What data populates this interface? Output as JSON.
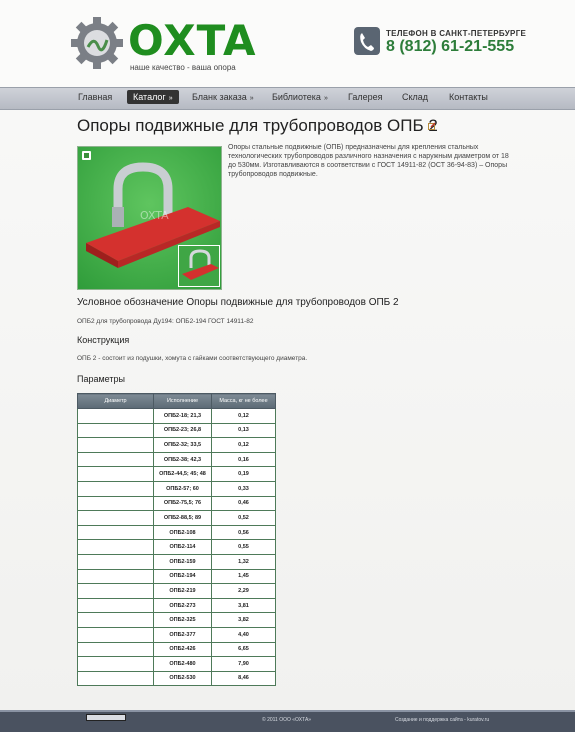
{
  "header": {
    "logo_text": "OXTA",
    "slogan": "наше качество - ваша опора",
    "phone_label": "ТЕЛЕФОН В САНКТ-ПЕТЕРБУРГЕ",
    "phone_number": "8 (812) 61-21-555"
  },
  "nav": [
    {
      "label": "Главная",
      "arrow": ""
    },
    {
      "label": "Каталог",
      "arrow": "»"
    },
    {
      "label": "Бланк заказа",
      "arrow": "»"
    },
    {
      "label": "Библиотека",
      "arrow": "»"
    },
    {
      "label": "Галерея",
      "arrow": ""
    },
    {
      "label": "Склад",
      "arrow": ""
    },
    {
      "label": "Контакты",
      "arrow": ""
    }
  ],
  "page": {
    "title": "Опоры подвижные для трубопроводов ОПБ 2",
    "description": "Опоры стальные подвижные (ОПБ) предназначены для крепления стальных технологических трубопроводов различного назначения с наружным диаметром от 18 до 530мм. Изготавливаются в соответствии с ГОСТ 14911-82 (ОСТ 36-94-83)  – Опоры трубопроводов подвижные.",
    "watermark": "OXTA",
    "subtitle_designation": "Условное обозначение Опоры подвижные для трубопроводов ОПБ 2",
    "designation_text": "ОПБ2 для трубопровода Ду194: ОПБ2-194 ГОСТ 14911-82",
    "subtitle_construction": "Конструкция",
    "construction_text": "ОПБ 2 - состоит из подушки, хомута с гайками соответствующего диаметра.",
    "subtitle_params": "Параметры"
  },
  "table": {
    "headers": [
      "Диаметр",
      "Исполнение",
      "Масса, кг не более"
    ],
    "rows": [
      [
        "",
        "ОПБ2-18; 21,3",
        "0,12"
      ],
      [
        "",
        "ОПБ2-23; 26,8",
        "0,13"
      ],
      [
        "",
        "ОПБ2-32; 33,5",
        "0,12"
      ],
      [
        "",
        "ОПБ2-38; 42,3",
        "0,16"
      ],
      [
        "",
        "ОПБ2-44,5; 45; 48",
        "0,19"
      ],
      [
        "",
        "ОПБ2-57; 60",
        "0,33"
      ],
      [
        "",
        "ОПБ2-75,5; 76",
        "0,46"
      ],
      [
        "",
        "ОПБ2-88,5; 89",
        "0,52"
      ],
      [
        "",
        "ОПБ2-108",
        "0,56"
      ],
      [
        "",
        "ОПБ2-114",
        "0,55"
      ],
      [
        "",
        "ОПБ2-159",
        "1,32"
      ],
      [
        "",
        "ОПБ2-194",
        "1,45"
      ],
      [
        "",
        "ОПБ2-219",
        "2,29"
      ],
      [
        "",
        "ОПБ2-273",
        "3,81"
      ],
      [
        "",
        "ОПБ2-325",
        "3,82"
      ],
      [
        "",
        "ОПБ2-377",
        "4,40"
      ],
      [
        "",
        "ОПБ2-426",
        "6,65"
      ],
      [
        "",
        "ОПБ2-480",
        "7,90"
      ],
      [
        "",
        "ОПБ2-530",
        "8,46"
      ]
    ]
  },
  "footer": {
    "copyright": "© 2011 ООО «ОХТА»",
    "credits": "Создание и поддержка сайта - kuratov.ru"
  },
  "colors": {
    "brand": "#1f8d1f",
    "phone": "#2d7d3a",
    "nav_bg": "#c4c8d0",
    "footer_bg": "#4a5260"
  }
}
